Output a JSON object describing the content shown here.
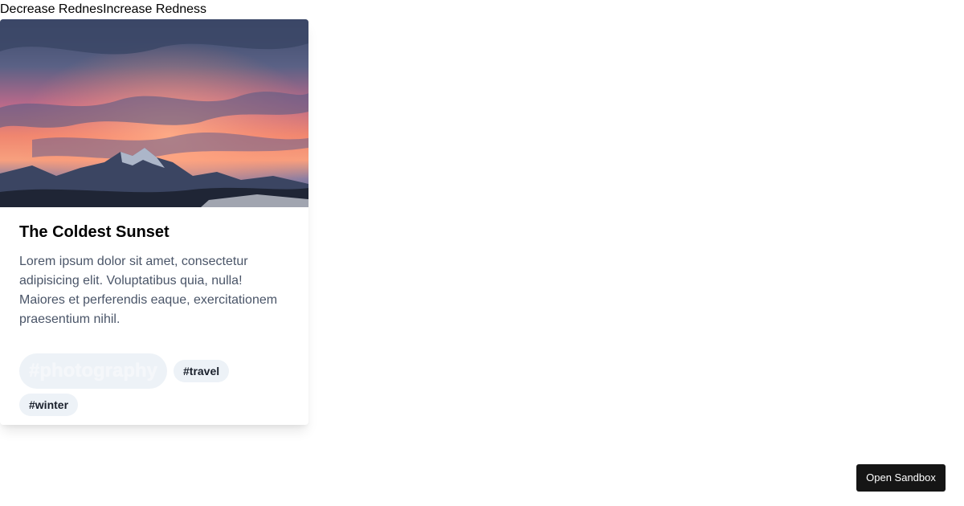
{
  "controls": {
    "decrease_label": "Decrease Rednes",
    "increase_label": "Increase Redness"
  },
  "card": {
    "title": "The Coldest Sunset",
    "text": "Lorem ipsum dolor sit amet, consectetur adipisicing elit. Voluptatibus quia, nulla! Maiores et perferendis eaque, exercitationem praesentium nihil.",
    "tags": [
      "#photography",
      "#travel",
      "#winter"
    ]
  },
  "sandbox": {
    "label": "Open Sandbox"
  },
  "colors": {
    "tag_bg": "#edf2f7",
    "text_muted": "#4a5568",
    "sandbox_bg": "#151515"
  }
}
